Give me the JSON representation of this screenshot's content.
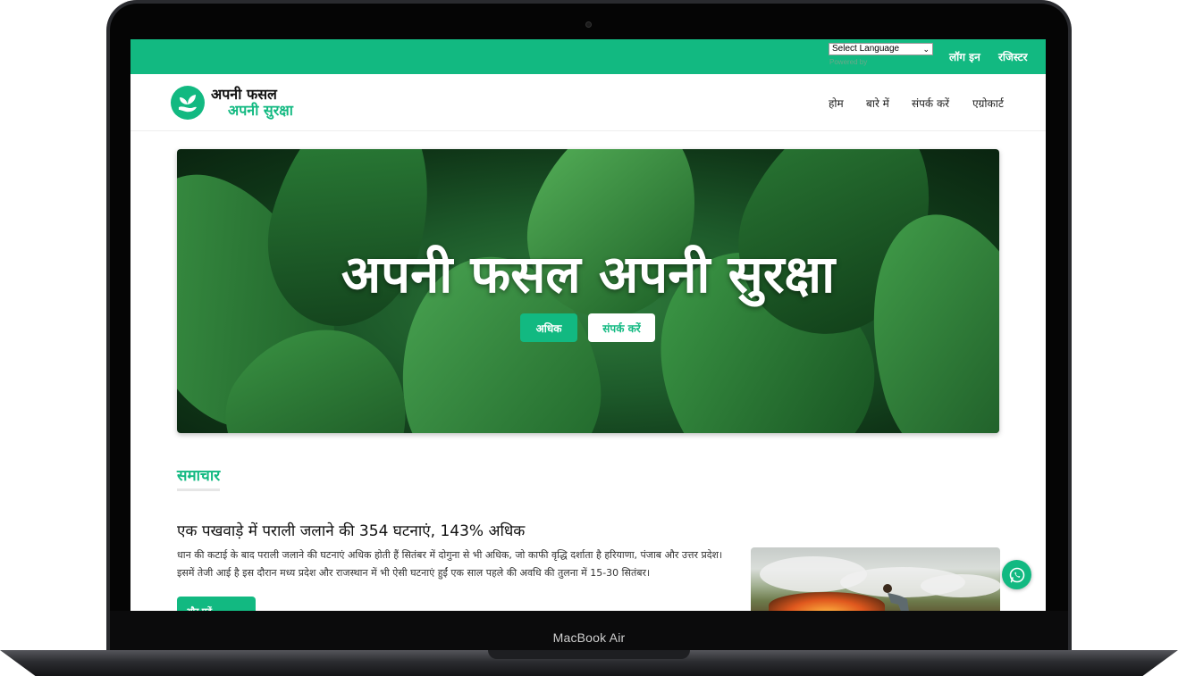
{
  "device": {
    "label": "MacBook Air"
  },
  "topbar": {
    "language_select": "Select Language",
    "powered_by": "Powered by",
    "login": "लॉग इन",
    "register": "रजिस्टर"
  },
  "brand": {
    "line1": "अपनी फसल",
    "line2": "अपनी सुरक्षा",
    "icon": "hand-sprout-icon"
  },
  "nav": {
    "items": [
      {
        "label": "होम"
      },
      {
        "label": "बारे में"
      },
      {
        "label": "संपर्क करें"
      },
      {
        "label": "एग्रोकार्ट"
      }
    ]
  },
  "hero": {
    "title": "अपनी फसल अपनी सुरक्षा",
    "primary_button": "अधिक",
    "secondary_button": "संपर्क करें"
  },
  "news": {
    "section_title": "समाचार",
    "items": [
      {
        "title": "एक पखवाड़े में पराली जलाने की 354 घटनाएं, 143% अधिक",
        "body": "धान की कटाई के बाद पराली जलाने की घटनाएं अधिक होती हैं सितंबर में दोगुना से भी अधिक, जो काफी वृद्धि दर्शाता है हरियाणा, पंजाब और उत्तर प्रदेश। इसमें तेजी आई है इस दौरान मध्य प्रदेश और राजस्थान में भी ऐसी घटनाएं हुईं एक साल पहले की अवधि की तुलना में 15-30 सितंबर।",
        "read_more": "और पढ़ें"
      }
    ]
  },
  "colors": {
    "accent": "#12b981",
    "text": "#111111"
  },
  "icons": {
    "chat": "whatsapp-icon"
  }
}
